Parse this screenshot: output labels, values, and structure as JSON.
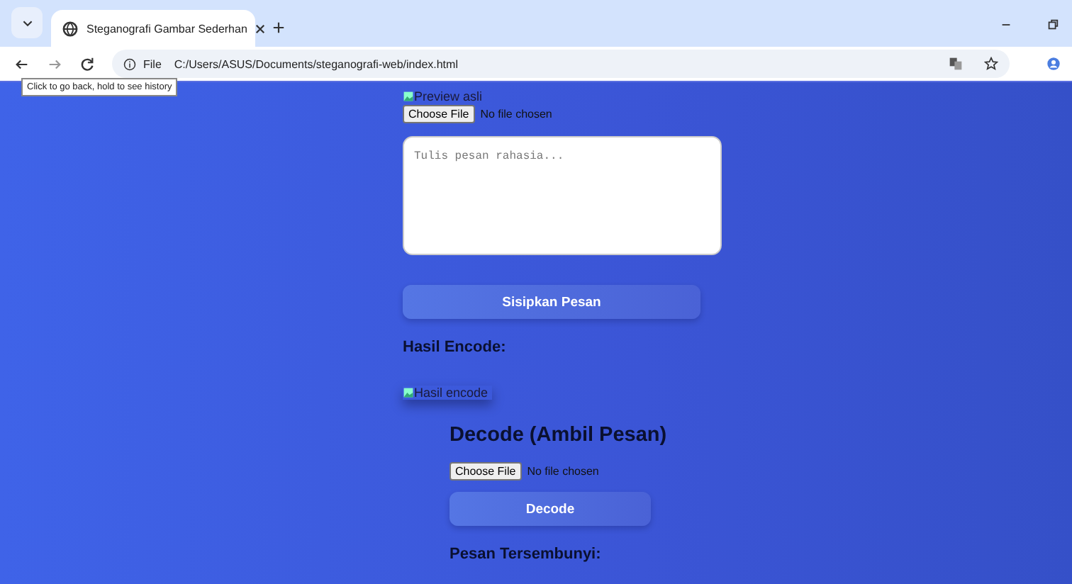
{
  "browser": {
    "tab": {
      "title": "Steganografi Gambar Sederhan",
      "selected": true
    },
    "address": {
      "scheme": "File",
      "url": "C:/Users/ASUS/Documents/steganografi-web/index.html"
    },
    "tooltip": "Click to go back, hold to see history"
  },
  "encode": {
    "preview_alt": "Preview asli",
    "file_button": "Choose File",
    "file_status": "No file chosen",
    "message": {
      "placeholder": "Tulis pesan rahasia..."
    },
    "submit": "Sisipkan Pesan",
    "result_heading": "Hasil Encode:",
    "result_alt": "Hasil encode"
  },
  "decode": {
    "heading": "Decode (Ambil Pesan)",
    "file_button": "Choose File",
    "file_status": "No file chosen",
    "submit": "Decode",
    "result_heading": "Pesan Tersembunyi:"
  }
}
